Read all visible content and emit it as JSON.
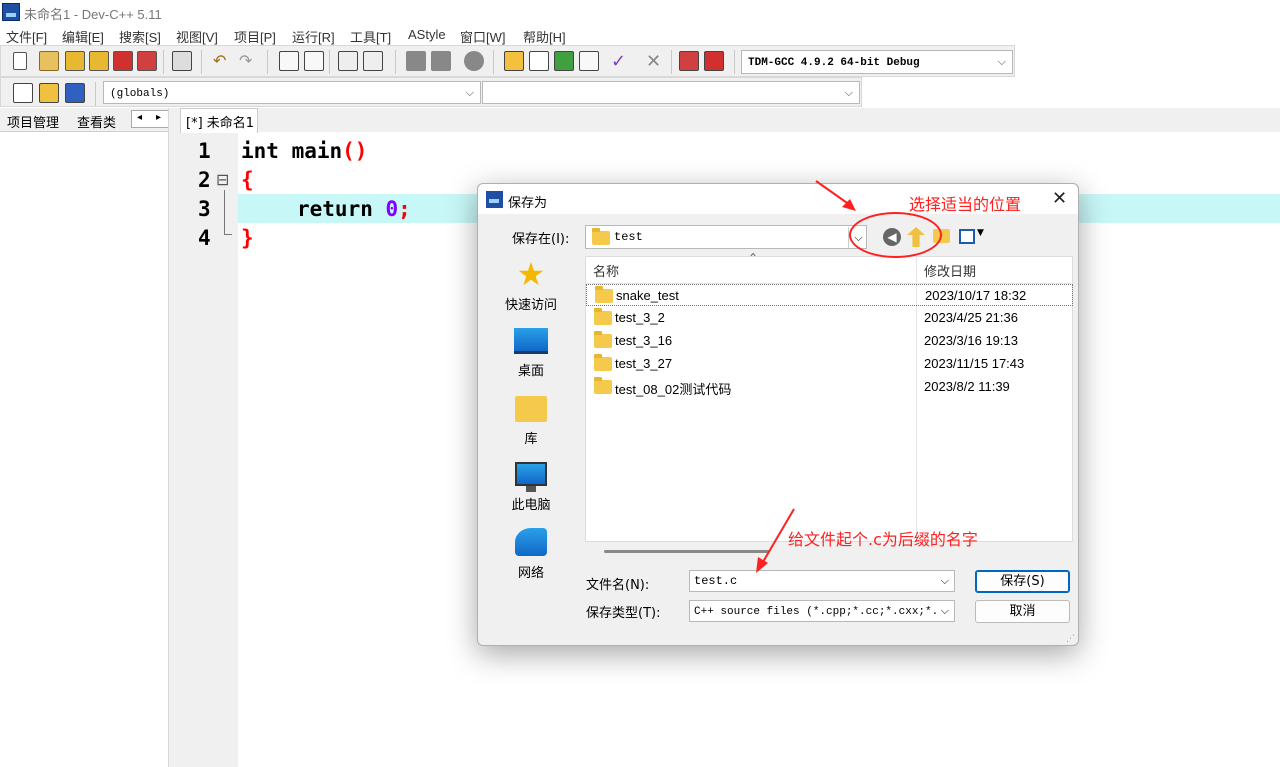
{
  "window": {
    "title": "未命名1 - Dev-C++ 5.11"
  },
  "menu": [
    "文件[F]",
    "编辑[E]",
    "搜索[S]",
    "视图[V]",
    "项目[P]",
    "运行[R]",
    "工具[T]",
    "AStyle",
    "窗口[W]",
    "帮助[H]"
  ],
  "toolbar": {
    "compiler_select": "TDM-GCC 4.9.2 64-bit Debug",
    "globals_select": "(globals)",
    "function_select": ""
  },
  "left_panel": {
    "tab_project": "项目管理",
    "tab_classes": "查看类",
    "nav_left": "◂",
    "nav_right": "▸"
  },
  "editor": {
    "tab": "[*] 未命名1",
    "line_numbers": [
      "1",
      "2",
      "3",
      "4"
    ],
    "fold_marker": "⊟",
    "code": {
      "l1_kw": "int",
      "l1_rest": " main",
      "l1_paren": "()",
      "l2": "{",
      "l3_kw": "return",
      "l3_num": "0",
      "l3_semi": ";",
      "l4": "}"
    }
  },
  "dialog": {
    "title": "保存为",
    "close": "✕",
    "save_in_label": "保存在(I):",
    "save_in_value": "test",
    "places": [
      "快速访问",
      "桌面",
      "库",
      "此电脑",
      "网络"
    ],
    "columns": {
      "name": "名称",
      "modified": "修改日期"
    },
    "files": [
      {
        "name": "snake_test",
        "date": "2023/10/17 18:32"
      },
      {
        "name": "test_3_2",
        "date": "2023/4/25 21:36"
      },
      {
        "name": "test_3_16",
        "date": "2023/3/16 19:13"
      },
      {
        "name": "test_3_27",
        "date": "2023/11/15 17:43"
      },
      {
        "name": "test_08_02测试代码",
        "date": "2023/8/2 11:39"
      }
    ],
    "filename_label": "文件名(N):",
    "filename_value": "test.c",
    "filetype_label": "保存类型(T):",
    "filetype_value": "C++ source files (*.cpp;*.cc;*.cxx;*.",
    "save_button": "保存(S)",
    "cancel_button": "取消"
  },
  "annotations": {
    "location_hint": "选择适当的位置",
    "filename_hint": "给文件起个.c为后缀的名字"
  },
  "colors": {
    "keyword": "#000000",
    "brace": "#ff0000",
    "number": "#8000ff",
    "highlight": "#c8f7f7",
    "annotation": "#ff2020"
  }
}
